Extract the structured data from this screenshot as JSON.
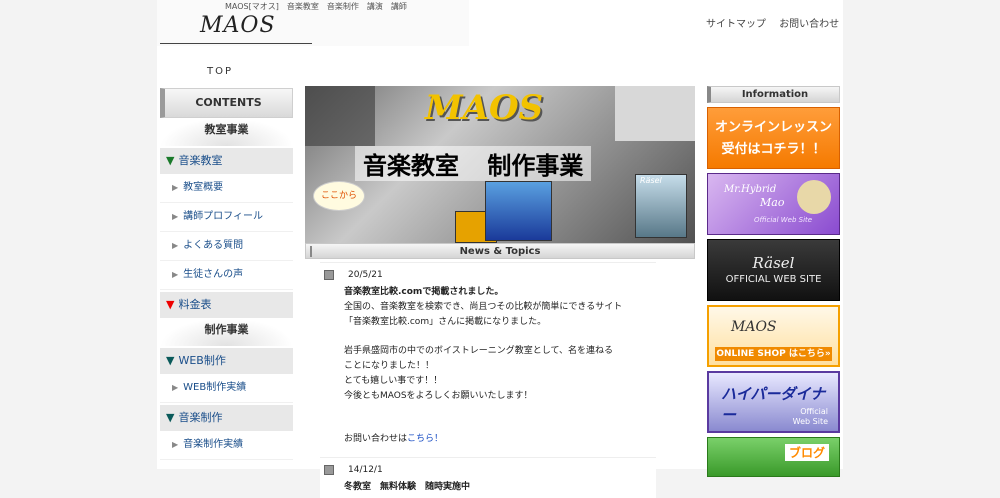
{
  "header": {
    "tagline": "MAOS[マオス]　音楽教室　音楽制作　講演　講師",
    "logo": "MAOS",
    "top_links": [
      "サイトマップ",
      "お問い合わせ"
    ],
    "nav_top": "TOP"
  },
  "sidebar": {
    "contents_label": "CONTENTS",
    "section1": "教室事業",
    "music_school": {
      "label": "音楽教室",
      "items": [
        "教室概要",
        "講師プロフィール",
        "よくある質問",
        "生徒さんの声"
      ]
    },
    "fees": "料金表",
    "section2": "制作事業",
    "web": {
      "label": "WEB制作",
      "items": [
        "WEB制作実績"
      ]
    },
    "music_production": {
      "label": "音楽制作",
      "items": [
        "音楽制作実績"
      ]
    }
  },
  "banner": {
    "logo": "MAOS",
    "title": "音楽教室 制作事業",
    "bubble": "ここから",
    "cd_label": "Räsel"
  },
  "news": {
    "header": "News & Topics",
    "item1": {
      "date": "20/5/21",
      "title": "音楽教室比較.comで掲載されました。",
      "lines": [
        "全国の、音楽教室を検索でき、尚且つその比較が簡単にできるサイト",
        "「音楽教室比較.com」さんに掲載になりました。"
      ],
      "lines2": [
        "岩手県盛岡市の中でのボイストレーニング教室として、名を連ねる",
        "ことになりました！！",
        "とても嬉しい事です！！",
        "今後ともMAOSをよろしくお願いいたします！"
      ],
      "contact_prefix": "お問い合わせは",
      "contact_link": "こちら！"
    },
    "item2": {
      "date": "14/12/1",
      "title": "冬教室　無料体験　随時実施中"
    }
  },
  "right": {
    "info_label": "Information",
    "online": [
      "オンラインレッスン",
      "受付はコチラ！！"
    ],
    "mao": {
      "line1": "Mr.Hybrid",
      "line2": "Mao",
      "line3": "Official Web Site"
    },
    "rasel": {
      "line1": "Räsel",
      "line2": "OFFICIAL WEB SITE"
    },
    "shop": {
      "line1": "MAOS",
      "bar": "ONLINE SHOP はこちら»"
    },
    "gunker": {
      "line1": "ハイパーダイナー",
      "line2a": "Official",
      "line2b": "Web Site"
    },
    "blog": "ブログ"
  },
  "colors": {
    "accent_link": "#1a4e8a",
    "orange": "#f57a00",
    "red_arrow": "#e00000",
    "green_arrow": "#1a7a2a"
  }
}
